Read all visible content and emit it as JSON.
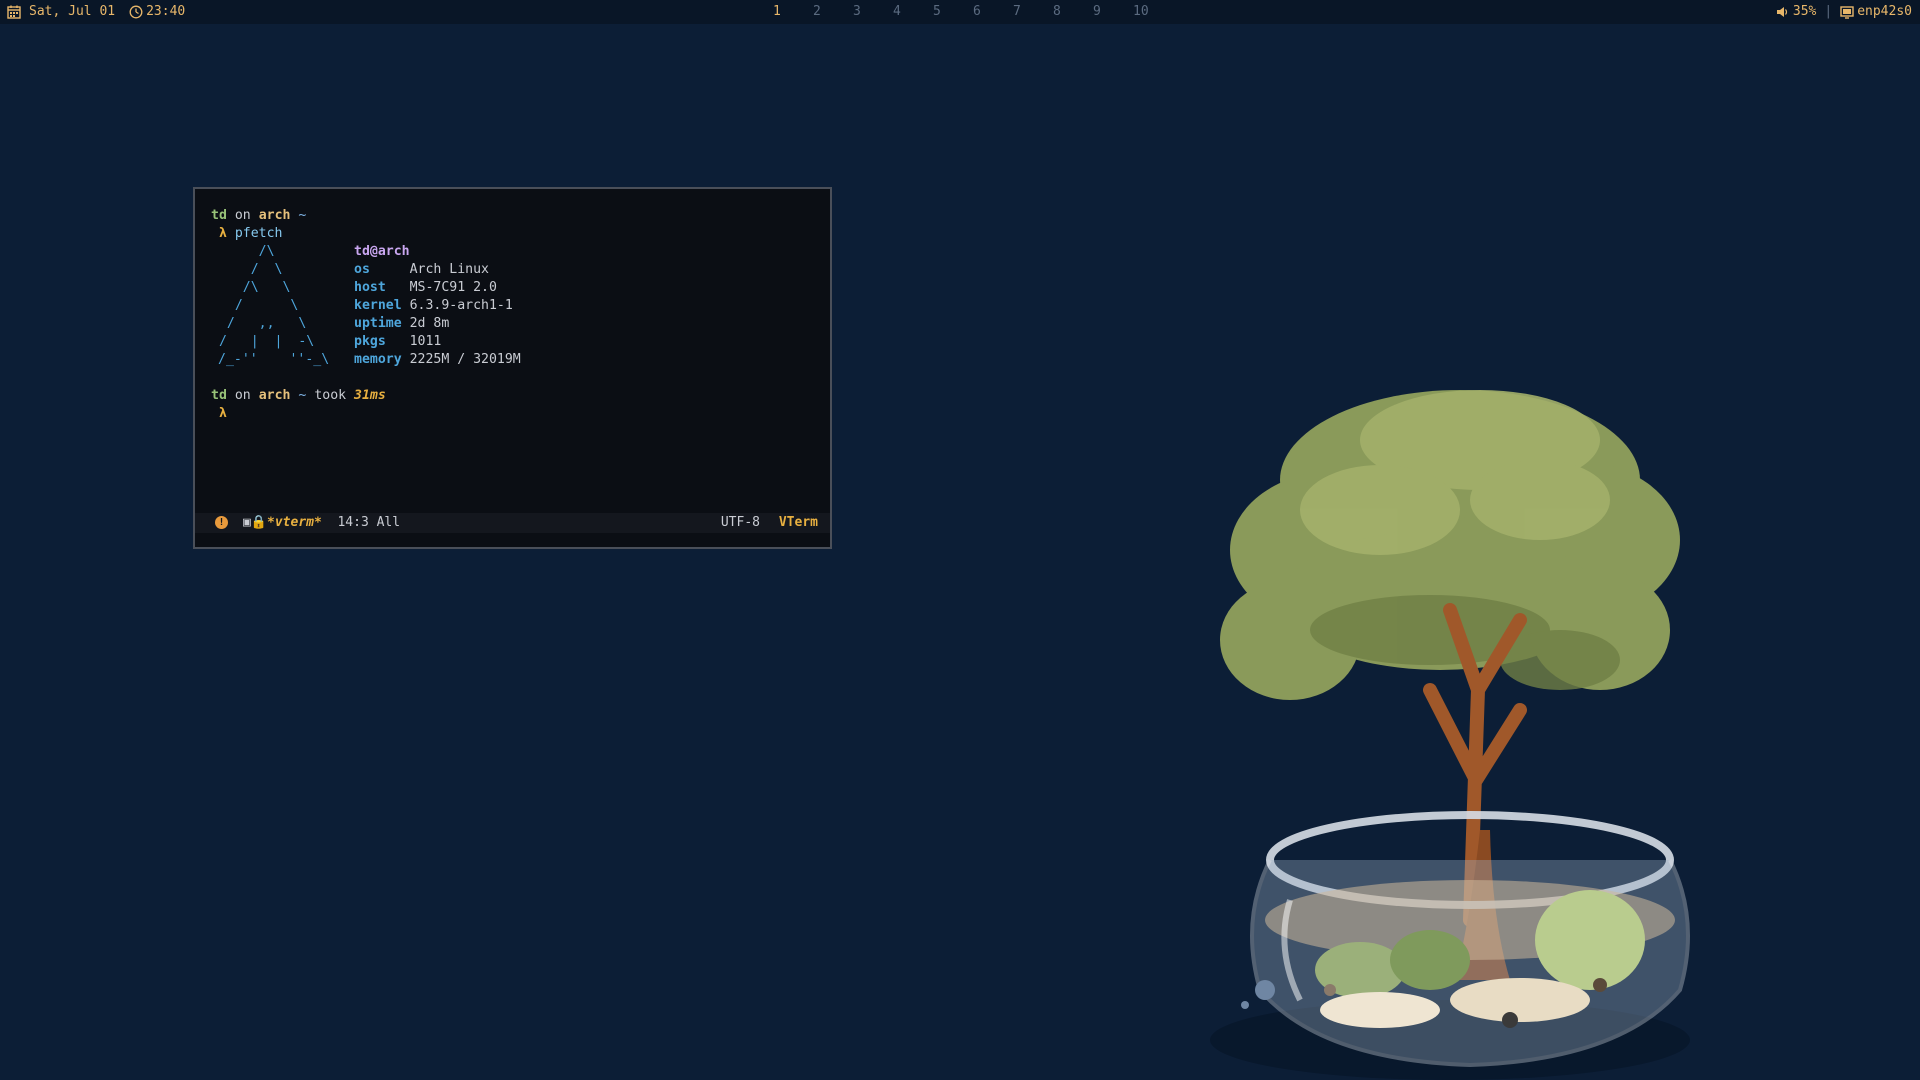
{
  "topbar": {
    "date": "Sat, Jul 01",
    "time": "23:40",
    "workspaces": [
      "1",
      "2",
      "3",
      "4",
      "5",
      "6",
      "7",
      "8",
      "9",
      "10"
    ],
    "active_workspace": "1",
    "volume": "35%",
    "network": "enp42s0",
    "separator": "|"
  },
  "terminal": {
    "prompt1": {
      "user": "td",
      "on": "on",
      "host": "arch",
      "dir": "~"
    },
    "lambda": "λ",
    "command": "pfetch",
    "logo_lines": [
      "      /\\",
      "     /  \\",
      "    /\\   \\",
      "   /      \\",
      "  /   ,,   \\",
      " /   |  |  -\\",
      "/_-''    ''-_\\"
    ],
    "fetch_title": "td@arch",
    "fetch": [
      {
        "key": "os",
        "pad": "     ",
        "value": "Arch Linux"
      },
      {
        "key": "host",
        "pad": "   ",
        "value": "MS-7C91 2.0"
      },
      {
        "key": "kernel",
        "pad": " ",
        "value": "6.3.9-arch1-1"
      },
      {
        "key": "uptime",
        "pad": " ",
        "value": "2d 8m"
      },
      {
        "key": "pkgs",
        "pad": "   ",
        "value": "1011"
      },
      {
        "key": "memory",
        "pad": " ",
        "value": "2225M / 32019M"
      }
    ],
    "prompt2": {
      "user": "td",
      "on": "on",
      "host": "arch",
      "dir": "~",
      "took_label": "took",
      "took_value": "31ms"
    }
  },
  "modeline": {
    "warning": "!",
    "buffer": "*vterm*",
    "position": "14:3 All",
    "encoding": "UTF-8",
    "mode": "VTerm"
  },
  "colors": {
    "background": "#0c1e36",
    "bar": "#091627",
    "accent": "#e8b76a",
    "terminal_bg": "#0b0e14"
  }
}
